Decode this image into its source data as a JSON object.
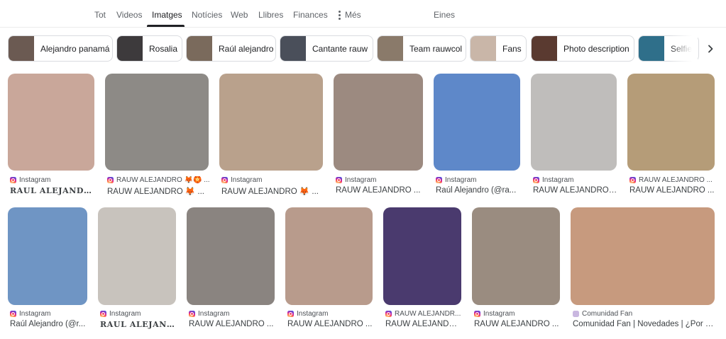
{
  "tabs": {
    "items": [
      "Tot",
      "Videos",
      "Imatges",
      "Notícies",
      "Web",
      "Llibres",
      "Finances",
      "Més"
    ],
    "active": "Imatges",
    "tools": "Eines"
  },
  "chips": [
    {
      "label": "Alejandro panamá",
      "color": "#6b5a52"
    },
    {
      "label": "Rosalia",
      "color": "#3d3a3c"
    },
    {
      "label": "Raúl alejandro",
      "color": "#7a6a5c"
    },
    {
      "label": "Cantante rauw",
      "color": "#4a4f5a"
    },
    {
      "label": "Team rauwcol",
      "color": "#8a7a6a"
    },
    {
      "label": "Fans",
      "color": "#c9b6a8"
    },
    {
      "label": "Photo description",
      "color": "#5a3a30"
    },
    {
      "label": "Selfie",
      "color": "#2f6f8a"
    }
  ],
  "results_row1": [
    {
      "source": "Instagram",
      "title": "𝐑𝐀𝐔𝐋 𝐀𝐋𝐄𝐉𝐀𝐍𝐃𝐑𝐎 ...",
      "serif": true,
      "icon": "instagram-icon",
      "bg": "#c9a79a"
    },
    {
      "source": "RAUW ALEJANDRO 🦊🏵️ ...",
      "title": "RAUW ALEJANDRO 🦊 ...",
      "serif": false,
      "icon": "instagram-icon",
      "bg": "#8d8a86"
    },
    {
      "source": "Instagram",
      "title": "RAUW ALEJANDRO 🦊 ...",
      "serif": false,
      "icon": "instagram-icon",
      "bg": "#b9a18c"
    },
    {
      "source": "Instagram",
      "title": "RAUW ALEJANDRO ...",
      "serif": false,
      "icon": "instagram-icon",
      "bg": "#9c8a80"
    },
    {
      "source": "Instagram",
      "title": "Raúl Alejandro (@ra...",
      "serif": false,
      "icon": "instagram-icon",
      "bg": "#5e88c9"
    },
    {
      "source": "Instagram",
      "title": "RAUW ALEJANDRO ...",
      "serif": false,
      "icon": "instagram-icon",
      "bg": "#bfbdbb"
    },
    {
      "source": "RAUW ALEJANDRO ...",
      "title": "RAUW ALEJANDRO ...",
      "serif": false,
      "icon": "instagram-icon",
      "bg": "#b59c78"
    }
  ],
  "results_row2": [
    {
      "source": "Instagram",
      "title": "Raúl Alejandro (@r...",
      "serif": false,
      "icon": "instagram-icon",
      "bg": "#6f95c4"
    },
    {
      "source": "Instagram",
      "title": "𝐑𝐀𝐔𝐋 𝐀𝐋𝐄𝐉𝐀𝐍𝐃𝐑𝐎...",
      "serif": true,
      "icon": "instagram-icon",
      "bg": "#c8c3bd"
    },
    {
      "source": "Instagram",
      "title": "RAUW ALEJANDRO ...",
      "serif": false,
      "icon": "instagram-icon",
      "bg": "#8a8480"
    },
    {
      "source": "Instagram",
      "title": "RAUW ALEJANDRO ...",
      "serif": false,
      "icon": "instagram-icon",
      "bg": "#b89b8c"
    },
    {
      "source": "RAUW ALEJANDR...",
      "title": "RAUW ALEJANDRO ...",
      "serif": false,
      "icon": "instagram-icon",
      "bg": "#4a3a6e"
    },
    {
      "source": "Instagram",
      "title": "RAUW ALEJANDRO ...",
      "serif": false,
      "icon": "instagram-icon",
      "bg": "#9a8c80"
    },
    {
      "source": "Comunidad Fan",
      "title": "Comunidad Fan | Novedades | ¿Por q...",
      "serif": false,
      "icon": "fan-icon",
      "bg": "#c79a7e"
    }
  ]
}
